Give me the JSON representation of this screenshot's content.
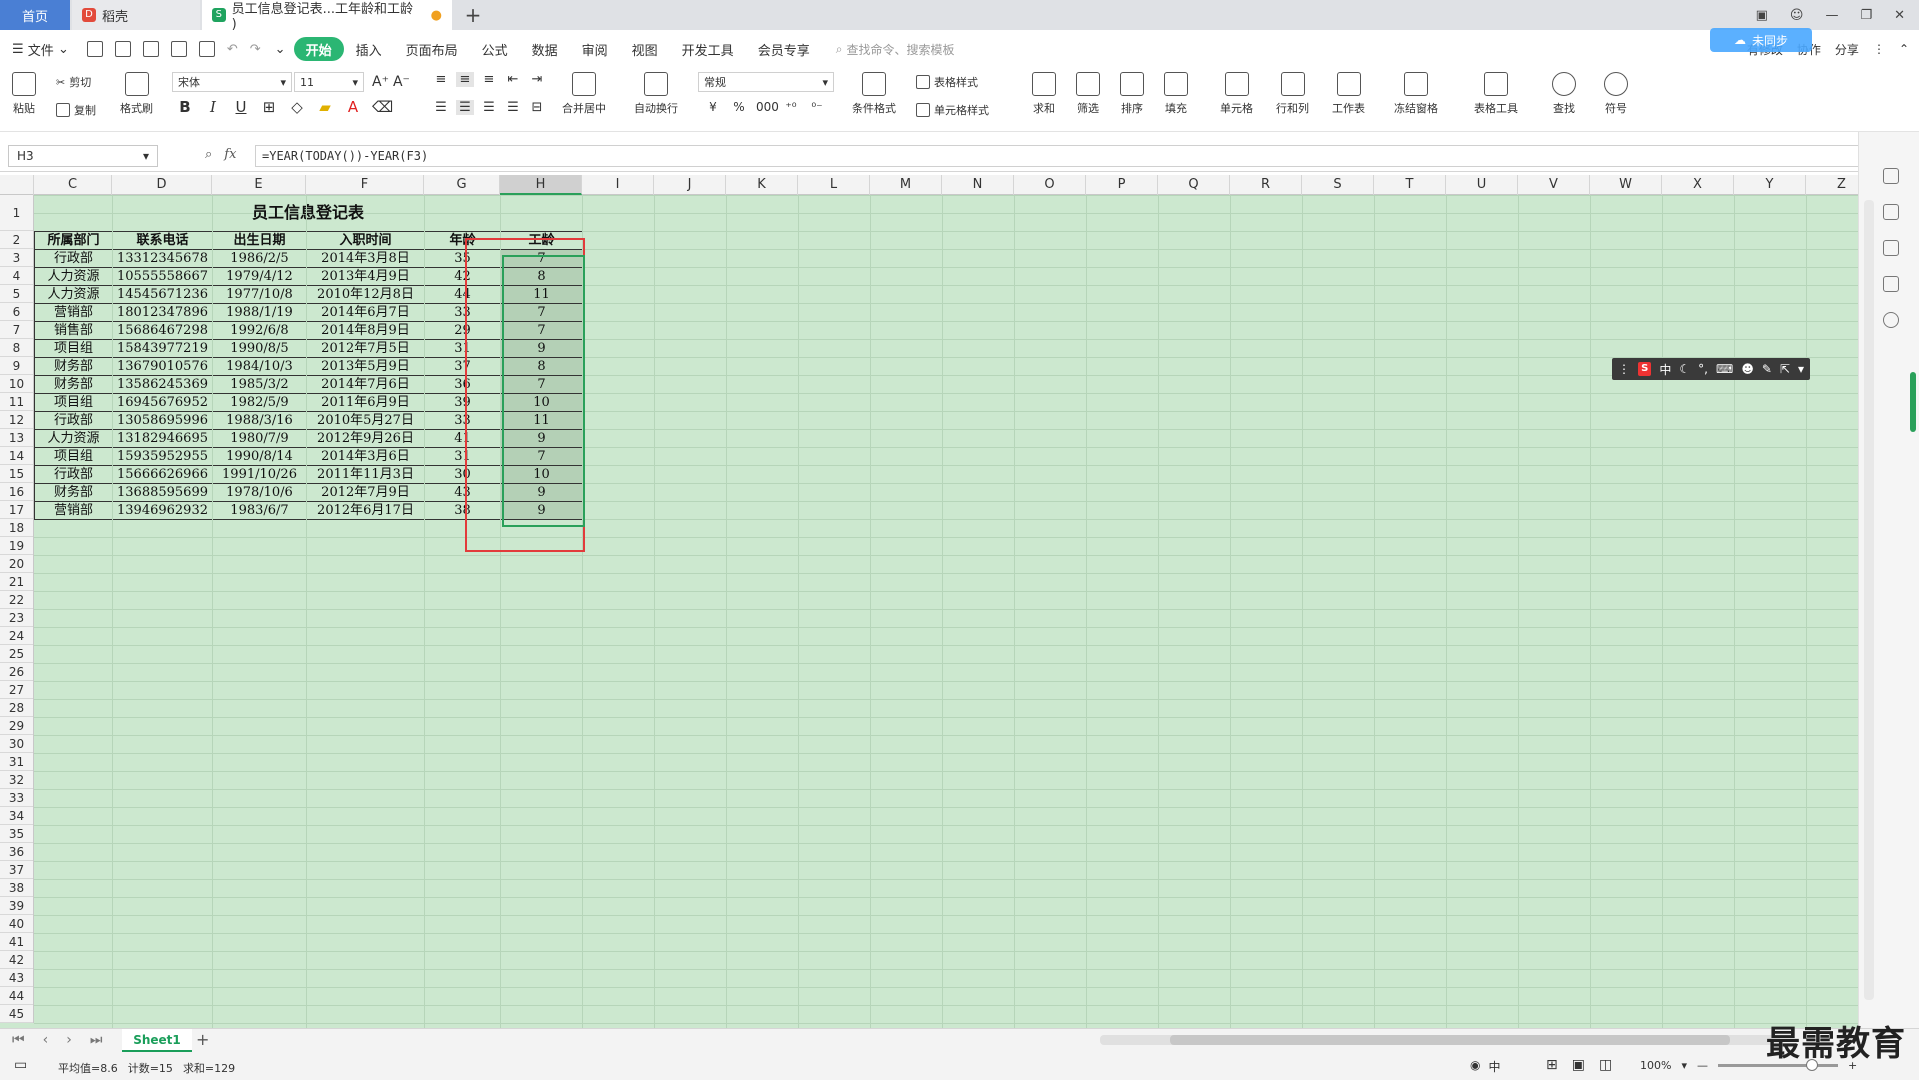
{
  "tabs": {
    "home": "首页",
    "daoke": "稻壳",
    "doc": "员工信息登记表...工年龄和工龄 )",
    "add": "+"
  },
  "menu": {
    "file": "文件",
    "items": [
      "开始",
      "插入",
      "页面布局",
      "公式",
      "数据",
      "审阅",
      "视图",
      "开发工具",
      "会员专享"
    ],
    "search": "查找命令、搜索模板",
    "unsync": "有修改",
    "collab": "协作",
    "share": "分享",
    "cloud": "未同步"
  },
  "ribbon": {
    "paste": "粘贴",
    "cut": "剪切",
    "copy": "复制",
    "format_painter": "格式刷",
    "font": "宋体",
    "size": "11",
    "numfmt": "常规",
    "merge": "合并居中",
    "wrap": "自动换行",
    "table_style": "表格样式",
    "cond_fmt": "条件格式",
    "cell_style": "单元格样式",
    "sum": "求和",
    "filter": "筛选",
    "sort": "排序",
    "fill": "填充",
    "cell": "单元格",
    "rowcol": "行和列",
    "sheet": "工作表",
    "freeze": "冻结窗格",
    "table_tools": "表格工具",
    "find": "查找",
    "symbol": "符号",
    "bold": "B",
    "italic": "I",
    "underline": "U",
    "currency": "¥",
    "percent": "%",
    "thousand": "000"
  },
  "formula": {
    "name": "H3",
    "fx": "fx",
    "value": "=YEAR(TODAY())-YEAR(F3)"
  },
  "columns": [
    "C",
    "D",
    "E",
    "F",
    "G",
    "H",
    "I",
    "J",
    "K",
    "L",
    "M",
    "N",
    "O",
    "P",
    "Q",
    "R",
    "S",
    "T",
    "U",
    "V",
    "W",
    "X",
    "Y",
    "Z"
  ],
  "rows": [
    "1",
    "2",
    "3",
    "4",
    "5",
    "6",
    "7",
    "8",
    "9",
    "10",
    "11",
    "12",
    "13",
    "14",
    "15",
    "16",
    "17",
    "18",
    "19",
    "20",
    "21",
    "22",
    "23",
    "24",
    "25",
    "26",
    "27",
    "28",
    "29",
    "30",
    "31",
    "32",
    "33",
    "34",
    "35",
    "36",
    "37",
    "38",
    "39",
    "40",
    "41",
    "42",
    "43",
    "44",
    "45"
  ],
  "sheet": {
    "title": "员工信息登记表",
    "headers": [
      "所属部门",
      "联系电话",
      "出生日期",
      "入职时间",
      "年龄",
      "工龄"
    ],
    "data": [
      [
        "行政部",
        "13312345678",
        "1986/2/5",
        "2014年3月8日",
        "35",
        "7"
      ],
      [
        "人力资源",
        "10555558667",
        "1979/4/12",
        "2013年4月9日",
        "42",
        "8"
      ],
      [
        "人力资源",
        "14545671236",
        "1977/10/8",
        "2010年12月8日",
        "44",
        "11"
      ],
      [
        "营销部",
        "18012347896",
        "1988/1/19",
        "2014年6月7日",
        "33",
        "7"
      ],
      [
        "销售部",
        "15686467298",
        "1992/6/8",
        "2014年8月9日",
        "29",
        "7"
      ],
      [
        "项目组",
        "15843977219",
        "1990/8/5",
        "2012年7月5日",
        "31",
        "9"
      ],
      [
        "财务部",
        "13679010576",
        "1984/10/3",
        "2013年5月9日",
        "37",
        "8"
      ],
      [
        "财务部",
        "13586245369",
        "1985/3/2",
        "2014年7月6日",
        "36",
        "7"
      ],
      [
        "项目组",
        "16945676952",
        "1982/5/9",
        "2011年6月9日",
        "39",
        "10"
      ],
      [
        "行政部",
        "13058695996",
        "1988/3/16",
        "2010年5月27日",
        "33",
        "11"
      ],
      [
        "人力资源",
        "13182946695",
        "1980/7/9",
        "2012年9月26日",
        "41",
        "9"
      ],
      [
        "项目组",
        "15935952955",
        "1990/8/14",
        "2014年3月6日",
        "31",
        "7"
      ],
      [
        "行政部",
        "15666626966",
        "1991/10/26",
        "2011年11月3日",
        "30",
        "10"
      ],
      [
        "财务部",
        "13688595699",
        "1978/10/6",
        "2012年7月9日",
        "43",
        "9"
      ],
      [
        "营销部",
        "13946962932",
        "1983/6/7",
        "2012年6月17日",
        "38",
        "9"
      ]
    ]
  },
  "ime": {
    "s": "S",
    "zh": "中"
  },
  "sheetbar": {
    "tab": "Sheet1",
    "add": "+"
  },
  "status": {
    "avg": "平均值=8.6",
    "count": "计数=15",
    "sum": "求和=129",
    "zh": "中",
    "zoom": "100%"
  },
  "watermark": "最需教育"
}
